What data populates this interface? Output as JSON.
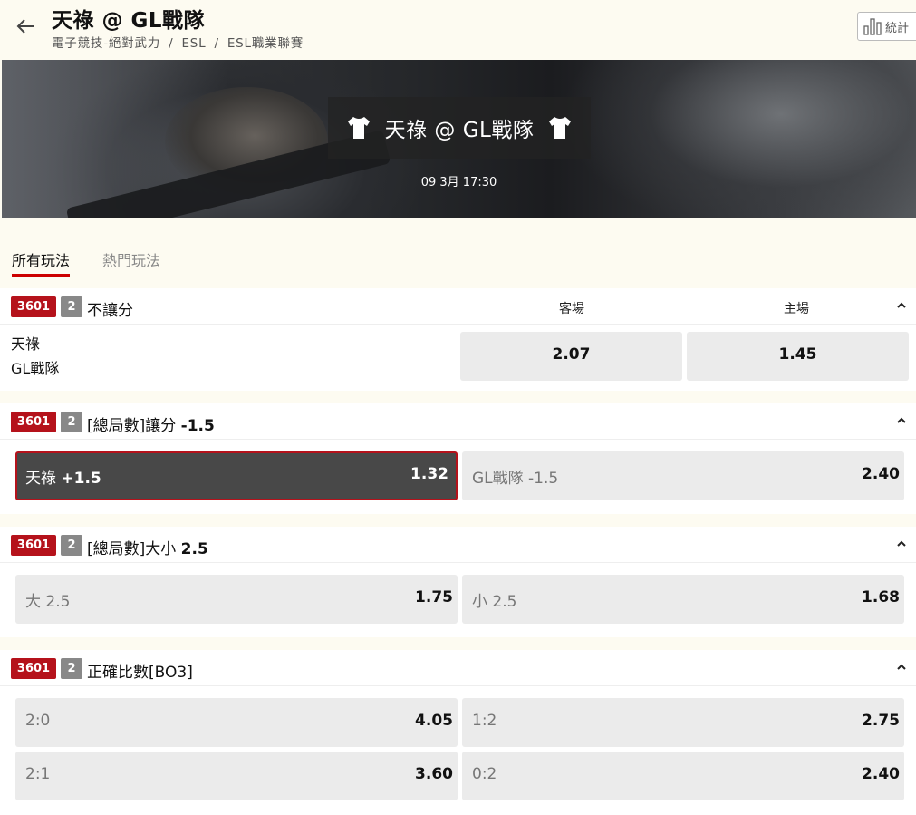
{
  "header": {
    "title": "天祿 @ GL戰隊",
    "breadcrumb": [
      "電子競技-絕對武力",
      "ESL",
      "ESL職業聯賽"
    ],
    "stats_label": "統計"
  },
  "banner": {
    "match_name": "天祿 @ GL戰隊",
    "match_time": "09 3月 17:30"
  },
  "tabs": [
    {
      "label": "所有玩法",
      "active": true
    },
    {
      "label": "熱門玩法",
      "active": false
    }
  ],
  "colors": {
    "accent": "#b5121b",
    "badge_gray": "#888888",
    "selected_bg": "#484848"
  },
  "markets": [
    {
      "id": "3601",
      "count": "2",
      "title": "不讓分",
      "title_bold": "",
      "col_headers": [
        "客場",
        "主場"
      ],
      "teams": [
        "天祿",
        "GL戰隊"
      ],
      "odds": [
        {
          "label": "",
          "label_bold": "",
          "value": "2.07"
        },
        {
          "label": "",
          "label_bold": "",
          "value": "1.45"
        }
      ]
    },
    {
      "id": "3601",
      "count": "2",
      "title": "[總局數]讓分 ",
      "title_bold": "-1.5",
      "odds": [
        {
          "label": "天祿 ",
          "label_bold": "+1.5",
          "value": "1.32",
          "selected": true
        },
        {
          "label": "GL戰隊 -1.5",
          "label_bold": "",
          "value": "2.40"
        }
      ]
    },
    {
      "id": "3601",
      "count": "2",
      "title": "[總局數]大小 ",
      "title_bold": "2.5",
      "odds": [
        {
          "label": "大 2.5",
          "label_bold": "",
          "value": "1.75"
        },
        {
          "label": "小 2.5",
          "label_bold": "",
          "value": "1.68"
        }
      ]
    },
    {
      "id": "3601",
      "count": "2",
      "title": "正確比數[BO3]",
      "title_bold": "",
      "odds": [
        {
          "label": "2:0",
          "label_bold": "",
          "value": "4.05"
        },
        {
          "label": "1:2",
          "label_bold": "",
          "value": "2.75"
        },
        {
          "label": "2:1",
          "label_bold": "",
          "value": "3.60"
        },
        {
          "label": "0:2",
          "label_bold": "",
          "value": "2.40"
        }
      ]
    }
  ]
}
